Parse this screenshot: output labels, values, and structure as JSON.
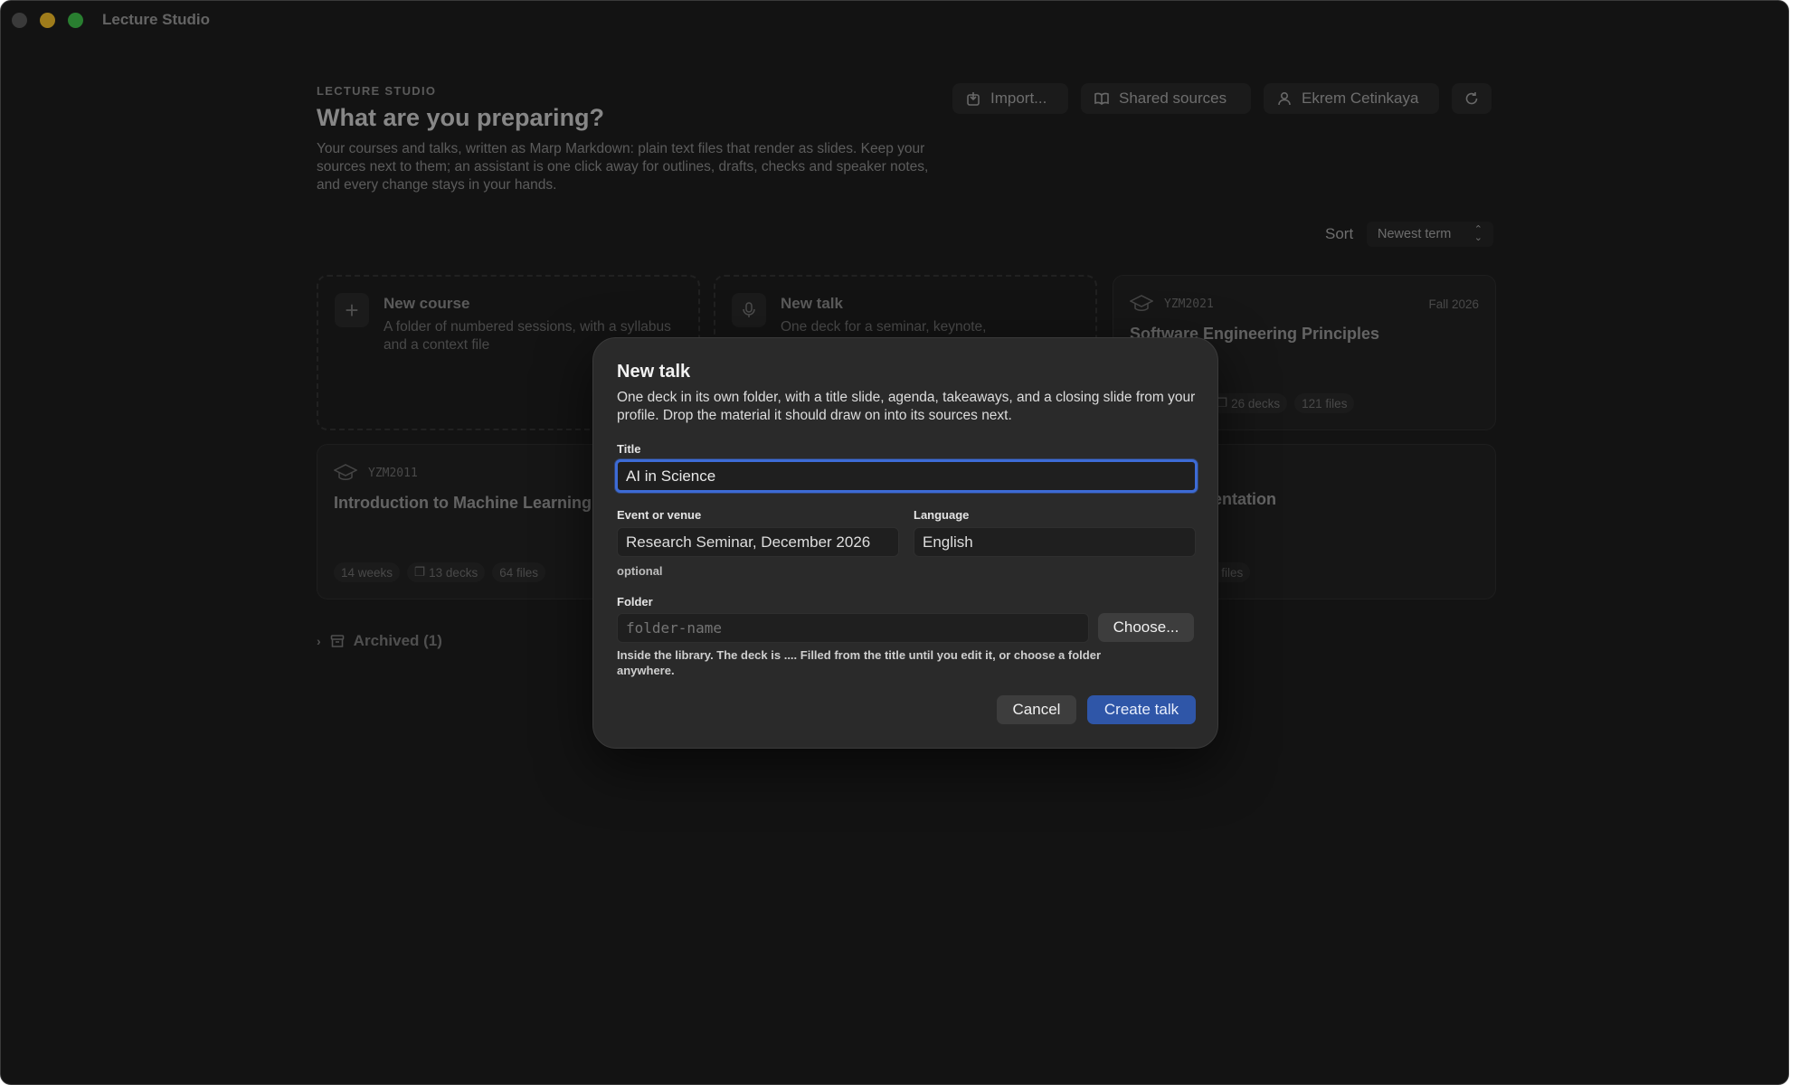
{
  "window": {
    "title": "Lecture Studio"
  },
  "header": {
    "eyebrow": "LECTURE STUDIO",
    "headline": "What are you preparing?",
    "intro": "Your courses and talks, written as Marp Markdown: plain text files that render as slides. Keep your sources next to them; an assistant is one click away for outlines, drafts, checks and speaker notes, and every change stays in your hands."
  },
  "toolbar": {
    "import_label": "Import...",
    "shared_label": "Shared sources",
    "user_label": "Ekrem Cetinkaya"
  },
  "sort": {
    "label": "Sort",
    "value": "Newest term"
  },
  "cards": {
    "new_course": {
      "title": "New course",
      "desc": "A folder of numbered sessions, with a syllabus and a context file"
    },
    "new_talk": {
      "title": "New talk",
      "desc": "One deck for a seminar, keynote,"
    },
    "se": {
      "code": "YZM2021",
      "term": "Fall 2026",
      "title": "Software Engineering Principles",
      "decks": "26 decks",
      "files": "121 files"
    },
    "ml": {
      "code": "YZM2011",
      "title": "Introduction to Machine Learning",
      "weeks": "14 weeks",
      "decks": "13 decks",
      "files": "64 files"
    },
    "pres": {
      "title": "sentation",
      "files": "1 files"
    }
  },
  "archived": {
    "label": "Archived (1)"
  },
  "modal": {
    "title": "New talk",
    "description": "One deck in its own folder, with a title slide, agenda, takeaways, and a closing slide from your profile. Drop the material it should draw on into its sources next.",
    "title_label": "Title",
    "title_value": "AI in Science",
    "venue_label": "Event or venue",
    "venue_value": "Research Seminar, December 2026",
    "venue_hint": "optional",
    "language_label": "Language",
    "language_value": "English",
    "folder_label": "Folder",
    "folder_placeholder": "folder-name",
    "choose_label": "Choose...",
    "folder_help": "Inside the library. The deck is .... Filled from the title until you edit it, or choose a folder anywhere.",
    "cancel_label": "Cancel",
    "create_label": "Create talk"
  },
  "colors": {
    "accent": "#2f56a8",
    "focus_ring": "#3d6bd6",
    "background": "#1e1e1e"
  }
}
